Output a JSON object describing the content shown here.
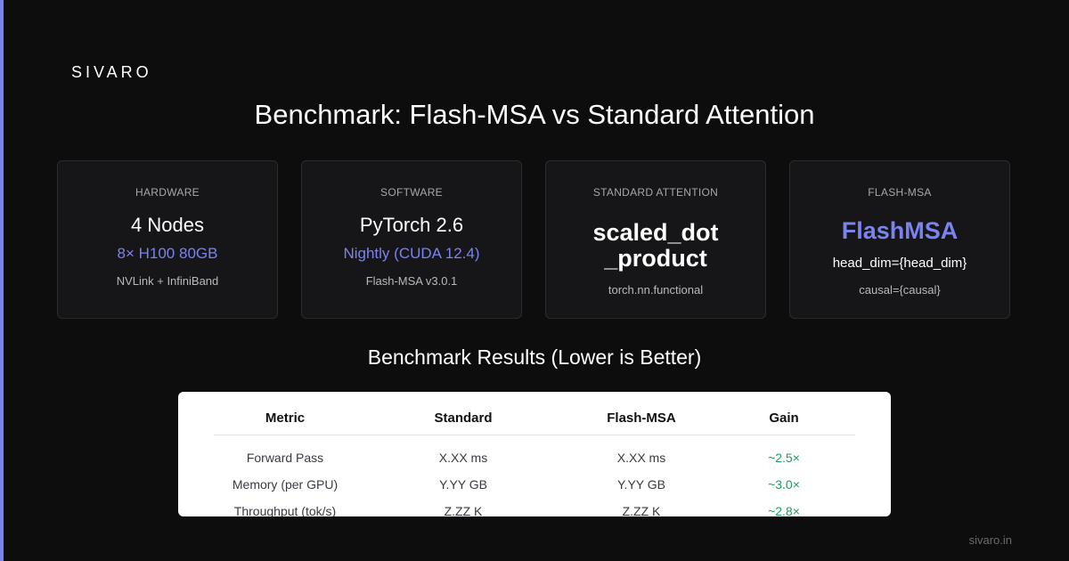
{
  "brand": "SIVARO",
  "colors": {
    "accent": "#7b83ee",
    "gain": "#1f9b62",
    "background": "#0d0d0e",
    "card": "#161618"
  },
  "title": "Benchmark: Flash-MSA vs Standard Attention",
  "cards": [
    {
      "label": "HARDWARE",
      "value": "4 Nodes",
      "sub": "8× H100 80GB",
      "note": "NVLink + InfiniBand"
    },
    {
      "label": "SOFTWARE",
      "value": "PyTorch 2.6",
      "sub": "Nightly (CUDA 12.4)",
      "note": "Flash-MSA v3.0.1"
    },
    {
      "label": "STANDARD ATTENTION",
      "value_line1": "scaled_dot",
      "value_line2": "_product",
      "note": "torch.nn.functional"
    },
    {
      "label": "FLASH-MSA",
      "value": "FlashMSA",
      "mid": "head_dim={head_dim}",
      "note": "causal={causal}"
    }
  ],
  "results": {
    "title": "Benchmark Results (Lower is Better)",
    "headers": [
      "Metric",
      "Standard",
      "Flash-MSA",
      "Gain"
    ],
    "rows": [
      [
        "Forward Pass",
        "X.XX ms",
        "X.XX ms",
        "~2.5×"
      ],
      [
        "Memory (per GPU)",
        "Y.YY GB",
        "Y.YY GB",
        "~3.0×"
      ],
      [
        "Throughput (tok/s)",
        "Z.ZZ K",
        "Z.ZZ K",
        "~2.8×"
      ]
    ]
  },
  "footer": "sivaro.in"
}
